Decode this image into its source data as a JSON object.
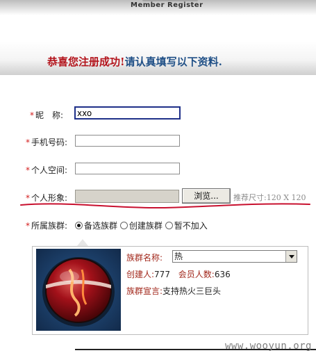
{
  "header": {
    "title": "Member Register"
  },
  "welcome": {
    "success": "恭喜您注册成功!",
    "instruction": "请认真填写以下资料."
  },
  "form": {
    "required_mark": "*",
    "nickname": {
      "label": "昵　称:",
      "value": "xxo"
    },
    "phone": {
      "label": "手机号码:",
      "value": ""
    },
    "space": {
      "label": "个人空间:",
      "value": ""
    },
    "avatar": {
      "label": "个人形象:",
      "browse_label": "浏览...",
      "hint": "推荐尺寸:120 X 120"
    },
    "clan": {
      "label": "所属族群:",
      "options": [
        "备选族群",
        "创建族群",
        "暂不加入"
      ],
      "selected": "备选族群"
    }
  },
  "clan_panel": {
    "name_label": "族群名称:",
    "name_value": "热",
    "creator_label": "创建人:",
    "creator_value": "777",
    "members_label": "会员人数:",
    "members_value": "636",
    "motto_label": "族群宣言:",
    "motto_value": "支持热火三巨头"
  },
  "watermark": "www.wooyun.org",
  "colors": {
    "required": "#d41b1b",
    "accent_red": "#b3141c",
    "accent_blue": "#1f4f86",
    "annotation": "#c8102e"
  }
}
